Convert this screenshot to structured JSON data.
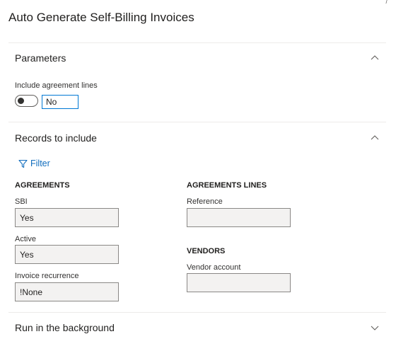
{
  "dialog": {
    "title": "Auto Generate Self-Billing Invoices",
    "corner_mark": "/"
  },
  "parameters": {
    "title": "Parameters",
    "expanded": true,
    "include_agreement_lines": {
      "label": "Include agreement lines",
      "value": "No",
      "on": false
    }
  },
  "records": {
    "title": "Records to include",
    "expanded": true,
    "filter_label": "Filter",
    "agreements": {
      "heading": "AGREEMENTS",
      "fields": [
        {
          "label": "SBI",
          "value": "Yes"
        },
        {
          "label": "Active",
          "value": "Yes"
        },
        {
          "label": "Invoice recurrence",
          "value": "!None"
        }
      ]
    },
    "agreement_lines": {
      "heading": "AGREEMENTS LINES",
      "fields": [
        {
          "label": "Reference",
          "value": ""
        }
      ]
    },
    "vendors": {
      "heading": "VENDORS",
      "fields": [
        {
          "label": "Vendor account",
          "value": ""
        }
      ]
    }
  },
  "background": {
    "title": "Run in the background",
    "expanded": false
  },
  "colors": {
    "accent": "#0078d4",
    "link": "#0f6cbd",
    "field_background": "#f3f2f1"
  }
}
